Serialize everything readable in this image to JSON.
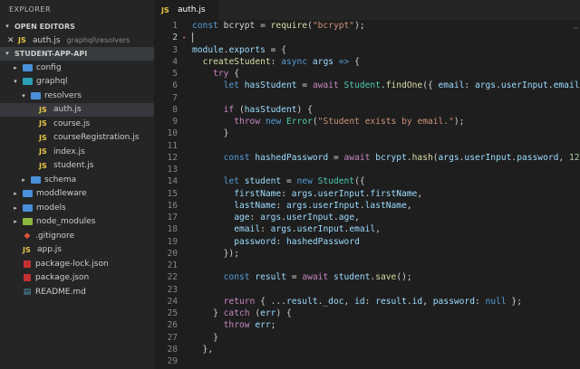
{
  "sidebar": {
    "title": "EXPLORER",
    "open_editors": {
      "label": "OPEN EDITORS",
      "file": "auth.js",
      "file_badge": "JS",
      "path": "graphql\\resolvers"
    },
    "project": {
      "label": "STUDENT-APP-API",
      "items": [
        {
          "label": "config",
          "kind": "folder",
          "color": "blue",
          "depth": 1,
          "open": false
        },
        {
          "label": "graphql",
          "kind": "folder",
          "color": "teal",
          "depth": 1,
          "open": true
        },
        {
          "label": "resolvers",
          "kind": "folder",
          "color": "blue",
          "depth": 2,
          "open": true
        },
        {
          "label": "auth.js",
          "kind": "js",
          "depth": 3,
          "active": true
        },
        {
          "label": "course.js",
          "kind": "js",
          "depth": 3
        },
        {
          "label": "courseRegistration.js",
          "kind": "js",
          "depth": 3
        },
        {
          "label": "index.js",
          "kind": "js",
          "depth": 3
        },
        {
          "label": "student.js",
          "kind": "js",
          "depth": 3
        },
        {
          "label": "schema",
          "kind": "folder",
          "color": "blue",
          "depth": 2,
          "open": false
        },
        {
          "label": "moddleware",
          "kind": "folder",
          "color": "blue",
          "depth": 1,
          "open": false
        },
        {
          "label": "models",
          "kind": "folder",
          "color": "blue",
          "depth": 1,
          "open": false
        },
        {
          "label": "node_modules",
          "kind": "folder",
          "color": "green",
          "depth": 1,
          "open": false
        },
        {
          "label": ".gitignore",
          "kind": "git",
          "depth": 1
        },
        {
          "label": "app.js",
          "kind": "js",
          "depth": 1
        },
        {
          "label": "package-lock.json",
          "kind": "npm",
          "depth": 1
        },
        {
          "label": "package.json",
          "kind": "npm",
          "depth": 1
        },
        {
          "label": "README.md",
          "kind": "md",
          "depth": 1
        }
      ]
    }
  },
  "editor": {
    "tab": {
      "badge": "JS",
      "label": "auth.js"
    },
    "lines": [
      {
        "n": "1",
        "tokens": [
          [
            "kw",
            "const"
          ],
          [
            "",
            " bcrypt = "
          ],
          [
            "fn",
            "require"
          ],
          [
            "",
            "("
          ],
          [
            "str",
            "\"bcrypt\""
          ],
          [
            "",
            ");"
          ]
        ]
      },
      {
        "n": "2",
        "tokens": [],
        "current": true
      },
      {
        "n": "3",
        "tokens": [
          [
            "var",
            "module"
          ],
          [
            "",
            "."
          ],
          [
            "var",
            "exports"
          ],
          [
            "",
            " = {"
          ]
        ]
      },
      {
        "n": "4",
        "tokens": [
          [
            "",
            "  "
          ],
          [
            "fn",
            "createStudent"
          ],
          [
            "",
            ": "
          ],
          [
            "kw",
            "async"
          ],
          [
            "",
            " "
          ],
          [
            "var",
            "args"
          ],
          [
            "",
            " "
          ],
          [
            "kw",
            "=>"
          ],
          [
            "",
            " {"
          ]
        ]
      },
      {
        "n": "5",
        "tokens": [
          [
            "",
            "    "
          ],
          [
            "kw2",
            "try"
          ],
          [
            "",
            " {"
          ]
        ]
      },
      {
        "n": "6",
        "tokens": [
          [
            "",
            "      "
          ],
          [
            "kw",
            "let"
          ],
          [
            "",
            " "
          ],
          [
            "var",
            "hasStudent"
          ],
          [
            "",
            " = "
          ],
          [
            "kw2",
            "await"
          ],
          [
            "",
            " "
          ],
          [
            "cls",
            "Student"
          ],
          [
            "",
            "."
          ],
          [
            "fn",
            "findOne"
          ],
          [
            "",
            "({ "
          ],
          [
            "var",
            "email"
          ],
          [
            "",
            ": "
          ],
          [
            "var",
            "args"
          ],
          [
            "",
            "."
          ],
          [
            "var",
            "userInput"
          ],
          [
            "",
            "."
          ],
          [
            "var",
            "email"
          ],
          [
            "",
            " });"
          ]
        ]
      },
      {
        "n": "7",
        "tokens": []
      },
      {
        "n": "8",
        "tokens": [
          [
            "",
            "      "
          ],
          [
            "kw2",
            "if"
          ],
          [
            "",
            " ("
          ],
          [
            "var",
            "hasStudent"
          ],
          [
            "",
            ") {"
          ]
        ]
      },
      {
        "n": "9",
        "tokens": [
          [
            "",
            "        "
          ],
          [
            "kw2",
            "throw"
          ],
          [
            "",
            " "
          ],
          [
            "kw",
            "new"
          ],
          [
            "",
            " "
          ],
          [
            "cls",
            "Error"
          ],
          [
            "",
            "("
          ],
          [
            "str",
            "\"Student exists by email.\""
          ],
          [
            "",
            ");"
          ]
        ]
      },
      {
        "n": "10",
        "tokens": [
          [
            "",
            "      }"
          ]
        ]
      },
      {
        "n": "11",
        "tokens": []
      },
      {
        "n": "12",
        "tokens": [
          [
            "",
            "      "
          ],
          [
            "kw",
            "const"
          ],
          [
            "",
            " "
          ],
          [
            "var",
            "hashedPassword"
          ],
          [
            "",
            " = "
          ],
          [
            "kw2",
            "await"
          ],
          [
            "",
            " "
          ],
          [
            "var",
            "bcrypt"
          ],
          [
            "",
            "."
          ],
          [
            "fn",
            "hash"
          ],
          [
            "",
            "("
          ],
          [
            "var",
            "args"
          ],
          [
            "",
            "."
          ],
          [
            "var",
            "userInput"
          ],
          [
            "",
            "."
          ],
          [
            "var",
            "password"
          ],
          [
            "",
            ", "
          ],
          [
            "num",
            "12"
          ],
          [
            "",
            ");"
          ]
        ]
      },
      {
        "n": "13",
        "tokens": []
      },
      {
        "n": "14",
        "tokens": [
          [
            "",
            "      "
          ],
          [
            "kw",
            "let"
          ],
          [
            "",
            " "
          ],
          [
            "var",
            "student"
          ],
          [
            "",
            " = "
          ],
          [
            "kw",
            "new"
          ],
          [
            "",
            " "
          ],
          [
            "cls",
            "Student"
          ],
          [
            "",
            "({"
          ]
        ]
      },
      {
        "n": "15",
        "tokens": [
          [
            "",
            "        "
          ],
          [
            "var",
            "firstName"
          ],
          [
            "",
            ": "
          ],
          [
            "var",
            "args"
          ],
          [
            "",
            "."
          ],
          [
            "var",
            "userInput"
          ],
          [
            "",
            "."
          ],
          [
            "var",
            "firstName"
          ],
          [
            "",
            ","
          ]
        ]
      },
      {
        "n": "16",
        "tokens": [
          [
            "",
            "        "
          ],
          [
            "var",
            "lastName"
          ],
          [
            "",
            ": "
          ],
          [
            "var",
            "args"
          ],
          [
            "",
            "."
          ],
          [
            "var",
            "userInput"
          ],
          [
            "",
            "."
          ],
          [
            "var",
            "lastName"
          ],
          [
            "",
            ","
          ]
        ]
      },
      {
        "n": "17",
        "tokens": [
          [
            "",
            "        "
          ],
          [
            "var",
            "age"
          ],
          [
            "",
            ": "
          ],
          [
            "var",
            "args"
          ],
          [
            "",
            "."
          ],
          [
            "var",
            "userInput"
          ],
          [
            "",
            "."
          ],
          [
            "var",
            "age"
          ],
          [
            "",
            ","
          ]
        ]
      },
      {
        "n": "18",
        "tokens": [
          [
            "",
            "        "
          ],
          [
            "var",
            "email"
          ],
          [
            "",
            ": "
          ],
          [
            "var",
            "args"
          ],
          [
            "",
            "."
          ],
          [
            "var",
            "userInput"
          ],
          [
            "",
            "."
          ],
          [
            "var",
            "email"
          ],
          [
            "",
            ","
          ]
        ]
      },
      {
        "n": "19",
        "tokens": [
          [
            "",
            "        "
          ],
          [
            "var",
            "password"
          ],
          [
            "",
            ": "
          ],
          [
            "var",
            "hashedPassword"
          ]
        ]
      },
      {
        "n": "20",
        "tokens": [
          [
            "",
            "      });"
          ]
        ]
      },
      {
        "n": "21",
        "tokens": []
      },
      {
        "n": "22",
        "tokens": [
          [
            "",
            "      "
          ],
          [
            "kw",
            "const"
          ],
          [
            "",
            " "
          ],
          [
            "var",
            "result"
          ],
          [
            "",
            " = "
          ],
          [
            "kw2",
            "await"
          ],
          [
            "",
            " "
          ],
          [
            "var",
            "student"
          ],
          [
            "",
            "."
          ],
          [
            "fn",
            "save"
          ],
          [
            "",
            "();"
          ]
        ]
      },
      {
        "n": "23",
        "tokens": []
      },
      {
        "n": "24",
        "tokens": [
          [
            "",
            "      "
          ],
          [
            "kw2",
            "return"
          ],
          [
            "",
            " { ..."
          ],
          [
            "var",
            "result"
          ],
          [
            "",
            "."
          ],
          [
            "var",
            "_doc"
          ],
          [
            "",
            ", "
          ],
          [
            "var",
            "id"
          ],
          [
            "",
            ": "
          ],
          [
            "var",
            "result"
          ],
          [
            "",
            "."
          ],
          [
            "var",
            "id"
          ],
          [
            "",
            ", "
          ],
          [
            "var",
            "password"
          ],
          [
            "",
            ": "
          ],
          [
            "kw",
            "null"
          ],
          [
            "",
            " };"
          ]
        ]
      },
      {
        "n": "25",
        "tokens": [
          [
            "",
            "    } "
          ],
          [
            "kw2",
            "catch"
          ],
          [
            "",
            " ("
          ],
          [
            "var",
            "err"
          ],
          [
            "",
            ") {"
          ]
        ]
      },
      {
        "n": "26",
        "tokens": [
          [
            "",
            "      "
          ],
          [
            "kw2",
            "throw"
          ],
          [
            "",
            " "
          ],
          [
            "var",
            "err"
          ],
          [
            "",
            ";"
          ]
        ]
      },
      {
        "n": "27",
        "tokens": [
          [
            "",
            "    }"
          ]
        ]
      },
      {
        "n": "28",
        "tokens": [
          [
            "",
            "  },"
          ]
        ]
      },
      {
        "n": "29",
        "tokens": []
      }
    ]
  }
}
